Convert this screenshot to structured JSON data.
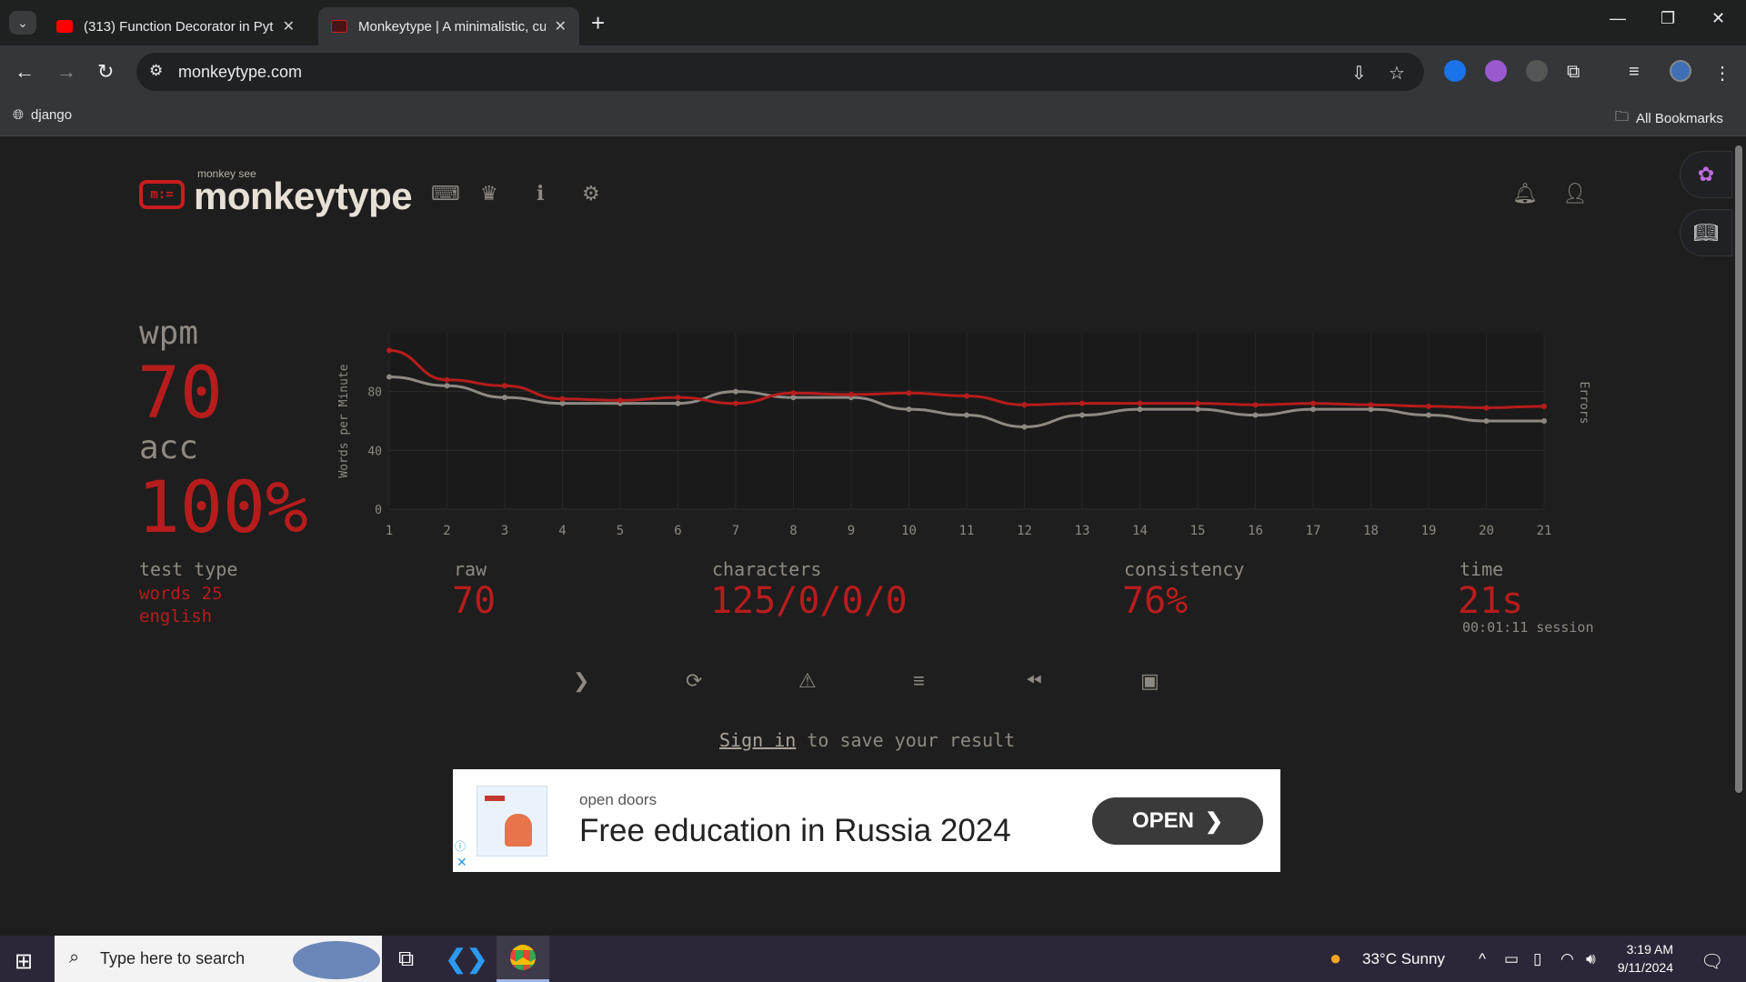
{
  "browser": {
    "tabs": [
      {
        "title": "(313) Function Decorator in Pyt",
        "favicon": "youtube-icon",
        "active": false
      },
      {
        "title": "Monkeytype | A minimalistic, cu",
        "favicon": "monkeytype-icon",
        "active": true
      }
    ],
    "url": "monkeytype.com",
    "bookmarks": [
      {
        "label": "django"
      }
    ],
    "all_bookmarks": "All Bookmarks"
  },
  "header": {
    "logo_box": "m:=",
    "logo_top": "monkey see",
    "logo_name": "monkeytype"
  },
  "results": {
    "wpm_label": "wpm",
    "wpm": "70",
    "acc_label": "acc",
    "acc": "100%",
    "test_type_label": "test type",
    "test_type_line1": "words 25",
    "test_type_line2": "english",
    "raw_label": "raw",
    "raw": "70",
    "characters_label": "characters",
    "characters": "125/0/0/0",
    "consistency_label": "consistency",
    "consistency": "76%",
    "time_label": "time",
    "time": "21s",
    "session": "00:01:11 session"
  },
  "chart_data": {
    "type": "line",
    "x": [
      1,
      2,
      3,
      4,
      5,
      6,
      7,
      8,
      9,
      10,
      11,
      12,
      13,
      14,
      15,
      16,
      17,
      18,
      19,
      20,
      21
    ],
    "series": [
      {
        "name": "wpm",
        "color": "#b71c1c",
        "values": [
          108,
          88,
          84,
          75,
          74,
          76,
          72,
          79,
          78,
          79,
          77,
          71,
          72,
          72,
          72,
          71,
          72,
          71,
          70,
          69,
          70
        ]
      },
      {
        "name": "raw",
        "color": "#8e8a83",
        "values": [
          90,
          84,
          76,
          72,
          72,
          72,
          80,
          76,
          76,
          68,
          64,
          56,
          64,
          68,
          68,
          64,
          68,
          68,
          64,
          60,
          60
        ]
      }
    ],
    "ylabel": "Words per Minute",
    "y2label": "Errors",
    "yticks": [
      0,
      40,
      80
    ],
    "ylim": [
      0,
      120
    ]
  },
  "actions": [
    "next-test",
    "restart",
    "report",
    "words-history",
    "replay",
    "screenshot"
  ],
  "signin": {
    "link": "Sign in",
    "rest": " to save your result"
  },
  "ad": {
    "brand": "open doors",
    "headline": "Free education in Russia 2024",
    "button": "OPEN"
  },
  "taskbar": {
    "search_placeholder": "Type here to search",
    "weather": "33°C  Sunny",
    "time": "3:19 AM",
    "date": "9/11/2024"
  }
}
